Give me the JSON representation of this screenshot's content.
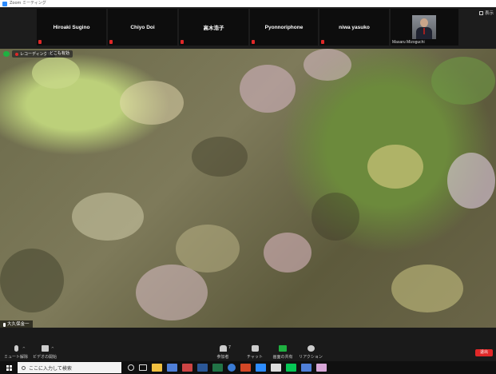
{
  "window": {
    "title": "Zoom ミーティング"
  },
  "gallery": {
    "participants": [
      {
        "name": "Hiroaki Sugino"
      },
      {
        "name": "Chiyo Doi"
      },
      {
        "name": "高木浩子"
      },
      {
        "name": "Pyonnoriphone"
      },
      {
        "name": "niwa yasuko"
      },
      {
        "name": "Masaru Mizoguchi"
      }
    ],
    "view_label": "表示"
  },
  "video": {
    "recording_label": "レコーディング中",
    "pause_label": "どこも有効",
    "speaker_name": "大久保金一"
  },
  "toolbar": {
    "mute_label": "ミュート解除",
    "video_label": "ビデオの開始",
    "participants_label": "参加者",
    "participants_count": "7",
    "chat_label": "チャット",
    "share_label": "画面の共有",
    "reactions_label": "リアクション",
    "end_label": "退出"
  },
  "taskbar": {
    "search_placeholder": "ここに入力して検索"
  },
  "colors": {
    "accent": "#2d8cff",
    "share": "#1fb141",
    "end": "#e02828"
  }
}
